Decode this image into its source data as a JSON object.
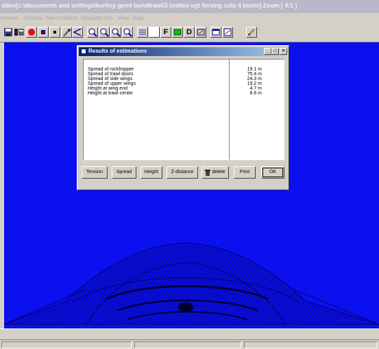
{
  "window": {
    "title": "ddeo[c:\\documents and settings\\kurt\\ny gemt bundtrawl\\3 bridles ugt forsing cuts 4 boots] Zoom [ 4:1 ]"
  },
  "menu": [
    "ements",
    "Options",
    "Tow condition",
    "Simulate",
    "Info",
    "View",
    "Help"
  ],
  "toolbar": {
    "buttons": [
      {
        "icon": "save-icon"
      },
      {
        "icon": "open-icon"
      },
      {
        "icon": "red-ball-icon"
      },
      {
        "icon": "tool-icon"
      },
      {
        "icon": "tool-icon"
      },
      {
        "icon": "tool-icon"
      },
      {
        "icon": "angle-icon"
      },
      {
        "icon": "zoom-in-icon"
      },
      {
        "icon": "zoom-out-icon"
      },
      {
        "icon": "zoom-icon"
      },
      {
        "icon": "zoom-icon"
      },
      {
        "icon": "arrows-icon"
      },
      {
        "icon": "blank-icon"
      },
      {
        "icon": "f-icon"
      },
      {
        "icon": "green-box-icon"
      },
      {
        "icon": "d-icon"
      },
      {
        "icon": "crane-icon"
      },
      {
        "icon": "window-icon"
      },
      {
        "icon": "chart-icon"
      },
      {
        "icon": "pencil-icon"
      }
    ],
    "f_label": "F",
    "d_label": "D"
  },
  "dialog": {
    "title": "Results of estimations",
    "caption_min": "_",
    "caption_max": "□",
    "caption_close": "×",
    "rows": [
      {
        "label": "Spread of rockhopper",
        "value": "19.1 m"
      },
      {
        "label": "Spread of trawl doors",
        "value": "75.4 m"
      },
      {
        "label": "Spread of side wings",
        "value": "24.3 m"
      },
      {
        "label": "Spread of upper wings",
        "value": "19.2 m"
      },
      {
        "label": "Height at wing end",
        "value": "4.7 m"
      },
      {
        "label": "Height at trawl center",
        "value": "8.6 m"
      }
    ],
    "buttons": {
      "tension": "Tension",
      "spread": "Spread",
      "height": "Height",
      "zdistance": "Z-distance",
      "delete": "delete",
      "print": "Print",
      "ok": "OK"
    }
  },
  "colors": {
    "viewport_bg": "#0a10ee",
    "titlebar_active": "#08246b",
    "net": "#000060"
  }
}
